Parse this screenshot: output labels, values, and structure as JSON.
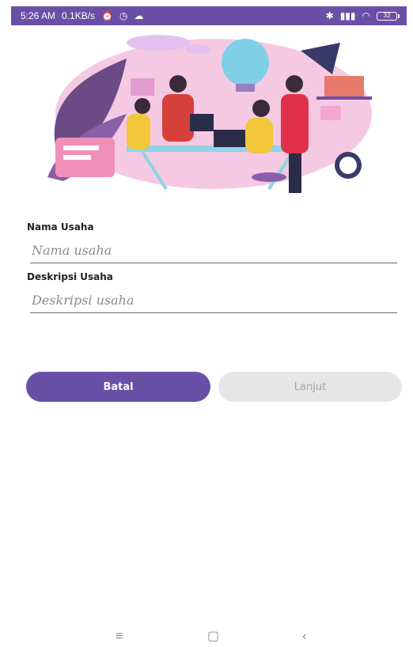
{
  "status_bar": {
    "time": "5:26 AM",
    "speed": "0.1KB/s",
    "battery": "32",
    "icons": [
      "alarm-icon",
      "clock-icon",
      "cloud-icon",
      "bluetooth-icon",
      "signal-icon",
      "wifi-icon",
      "battery-icon"
    ]
  },
  "form": {
    "nama_label": "Nama Usaha",
    "nama_placeholder": "Nama usaha",
    "nama_value": "",
    "deskripsi_label": "Deskripsi Usaha",
    "deskripsi_placeholder": "Deskripsi usaha",
    "deskripsi_value": ""
  },
  "buttons": {
    "batal": "Batal",
    "lanjut": "Lanjut"
  },
  "colors": {
    "accent": "#6a4fa6",
    "disabled_bg": "#e6e6e6",
    "disabled_text": "#a6a6a6"
  },
  "nav": {
    "icons": [
      "menu-icon",
      "home-icon",
      "back-icon"
    ]
  }
}
